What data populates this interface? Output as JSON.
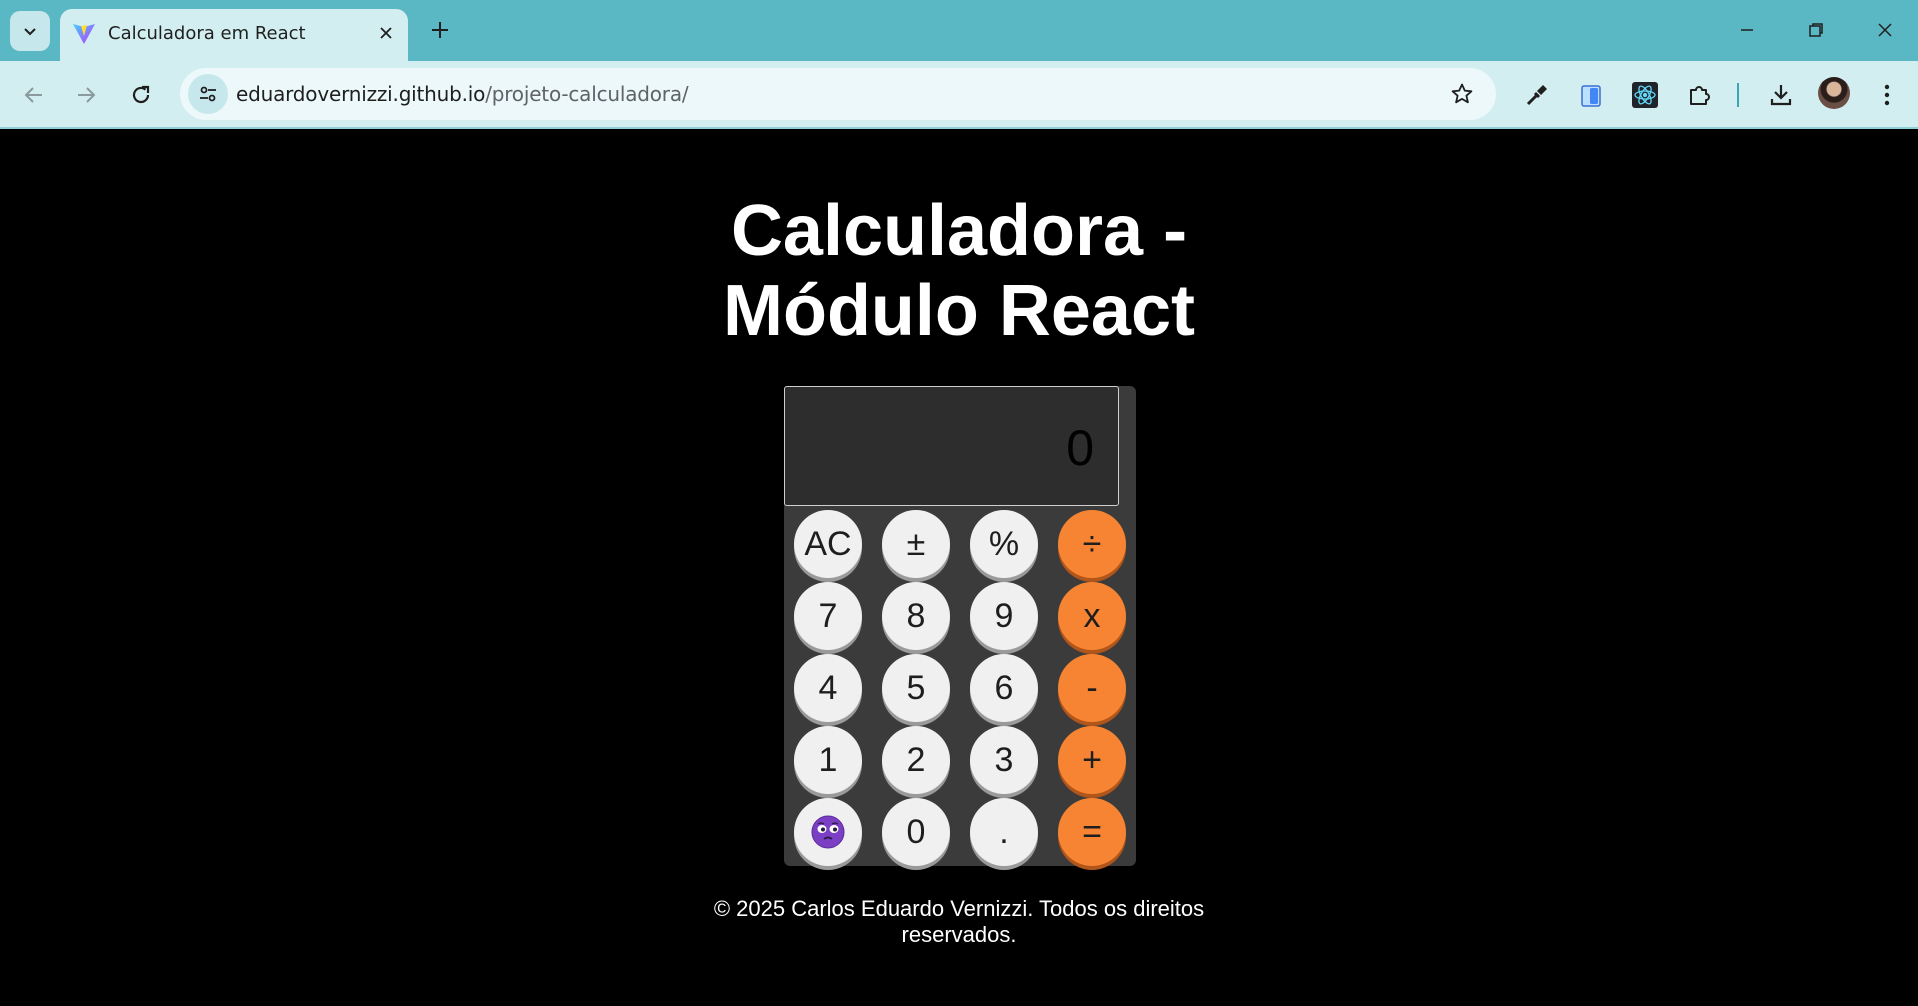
{
  "browser": {
    "tab_title": "Calculadora em React",
    "url_host": "eduardovernizzi.github.io",
    "url_path": "/projeto-calculadora/"
  },
  "page": {
    "title": "Calculadora -\nMódulo React",
    "display_value": "0",
    "footer": "© 2025 Carlos Eduardo Vernizzi. Todos os direitos reservados."
  },
  "keys": {
    "ac": "AC",
    "plus_minus": "±",
    "percent": "%",
    "divide": "÷",
    "seven": "7",
    "eight": "8",
    "nine": "9",
    "multiply": "x",
    "four": "4",
    "five": "5",
    "six": "6",
    "minus": "-",
    "one": "1",
    "two": "2",
    "three": "3",
    "plus": "+",
    "zero": "0",
    "decimal": ".",
    "equals": "="
  },
  "colors": {
    "chrome_tabstrip": "#5ab8c4",
    "chrome_toolbar": "#d3eef1",
    "page_background": "#000000",
    "operator_key": "#f78432",
    "number_key": "#f0f0f0"
  }
}
